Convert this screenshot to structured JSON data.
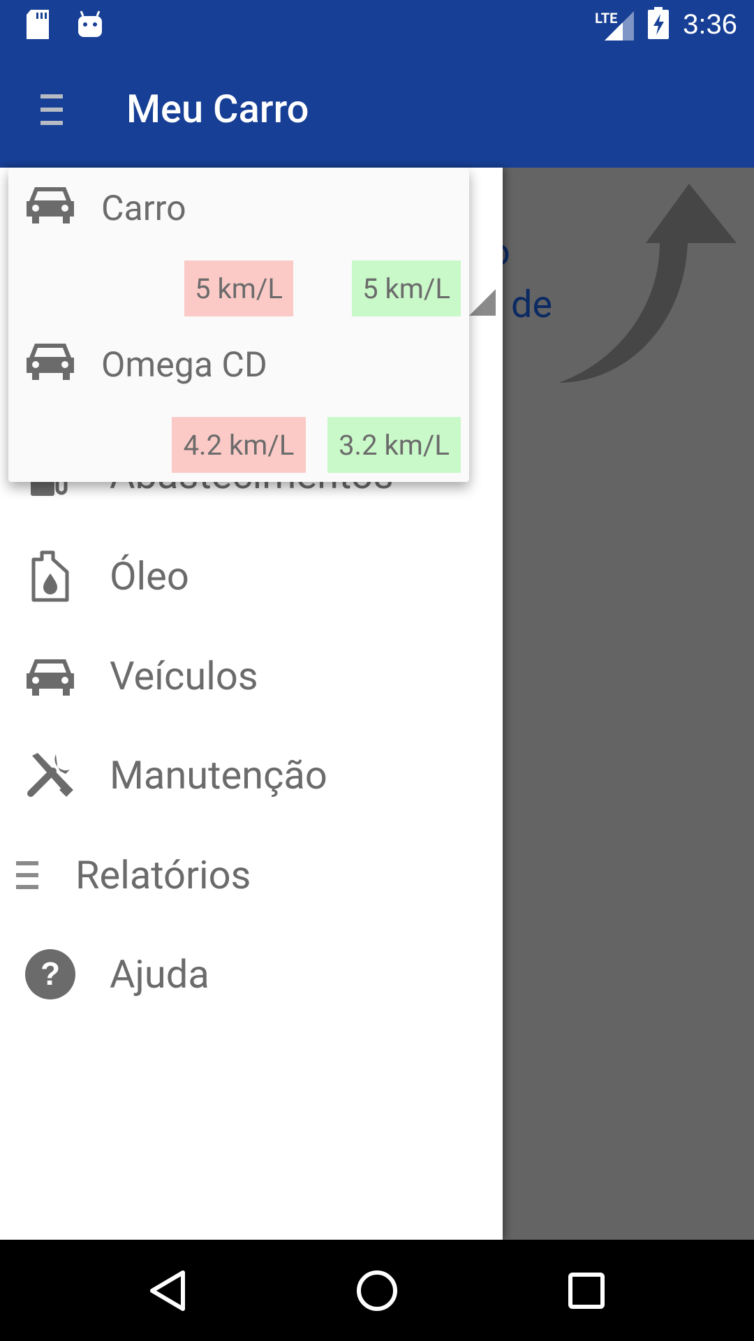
{
  "status_bar": {
    "network": "LTE",
    "time": "3:36"
  },
  "app_bar": {
    "title": "Meu Carro"
  },
  "background": {
    "text_line_1": "o",
    "text_line_2": "de"
  },
  "vehicle_selector": {
    "vehicles": [
      {
        "name": "Carro",
        "left_badge": "5 km/L",
        "right_badge": "5 km/L"
      },
      {
        "name": "Omega CD",
        "left_badge": "4.2 km/L",
        "right_badge": "3.2 km/L"
      }
    ]
  },
  "drawer": {
    "items": [
      {
        "label": "Abastecimentos",
        "icon": "fuel-pump-icon"
      },
      {
        "label": "Óleo",
        "icon": "oil-bottle-icon"
      },
      {
        "label": "Veículos",
        "icon": "car-icon"
      },
      {
        "label": "Manutenção",
        "icon": "tools-icon"
      },
      {
        "label": "Relatórios",
        "icon": "list-icon"
      },
      {
        "label": "Ajuda",
        "icon": "help-icon"
      }
    ]
  },
  "colors": {
    "primary": "#173f95",
    "badge_red": "#fbcac6",
    "badge_green": "#c9f8c9",
    "scrim": "#646464"
  }
}
